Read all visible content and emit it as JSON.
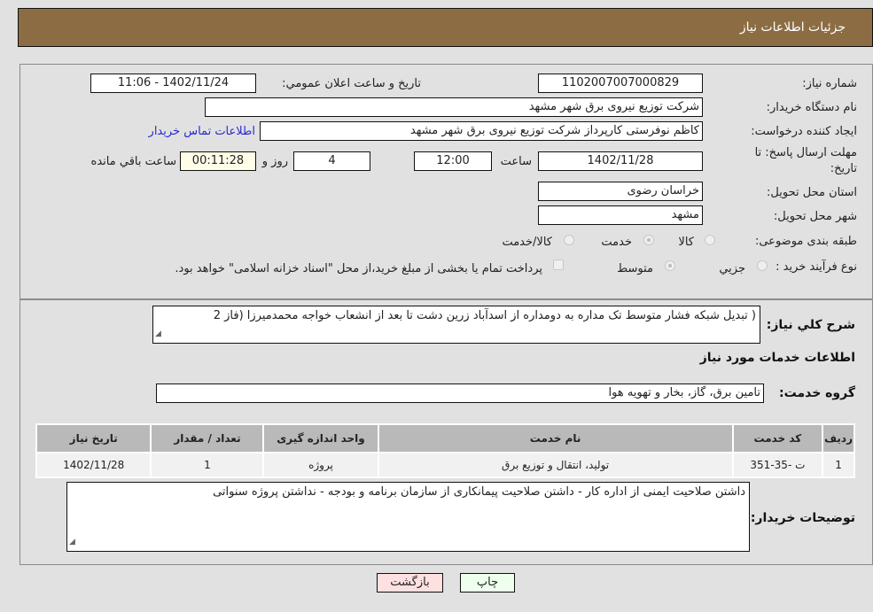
{
  "header": {
    "title": "جزئیات اطلاعات نیاز"
  },
  "form": {
    "need_number_label": "شماره نیاز:",
    "need_number": "1102007007000829",
    "announce_label": "تاریخ و ساعت اعلان عمومي:",
    "announce_value": "1402/11/24 - 11:06",
    "buyer_org_label": "نام دستگاه خریدار:",
    "buyer_org": "شرکت توزیع نیروی برق شهر مشهد",
    "creator_label": "ایجاد کننده درخواست:",
    "creator": "کاظم نوفرستی کارپرداز شرکت توزیع نیروی برق شهر مشهد",
    "contact_link": "اطلاعات تماس خریدار",
    "deadline_label_line1": "مهلت ارسال پاسخ: تا",
    "deadline_label_line2": "تاریخ:",
    "deadline_date": "1402/11/28",
    "time_label": "ساعت",
    "deadline_time": "12:00",
    "days_value": "4",
    "days_label": "روز و",
    "remaining_time": "00:11:28",
    "remaining_label": "ساعت باقي مانده",
    "province_label": "استان محل تحویل:",
    "province": "خراسان رضوی",
    "city_label": "شهر محل تحویل:",
    "city": "مشهد",
    "category_label": "طبقه بندی موضوعی:",
    "category_options": [
      "کالا",
      "خدمت",
      "کالا/خدمت"
    ],
    "category_selected": "خدمت",
    "process_label": "نوع فرآیند خرید :",
    "process_options": [
      "جزيي",
      "متوسط"
    ],
    "process_selected": "متوسط",
    "treasury_note": "پرداخت تمام یا بخشی از مبلغ خرید،از محل \"اسناد خزانه اسلامی\" خواهد بود."
  },
  "details": {
    "summary_label": "شرح كلي نياز:",
    "summary_text": "( تبدیل شبکه فشار متوسط تک مداره به دومداره از اسدآباد زرین دشت تا بعد از انشعاب خواجه محمدمیرزا (فاز 2",
    "services_heading": "اطلاعات خدمات مورد نیاز",
    "service_group_label": "گروه خدمت:",
    "service_group": "تامین برق، گاز، بخار و تهویه هوا",
    "table": {
      "headers": [
        "رديف",
        "کد خدمت",
        "نام خدمت",
        "واحد اندازه گیری",
        "تعداد / مقدار",
        "تاریخ نیاز"
      ],
      "rows": [
        [
          "1",
          "ت -35-351",
          "تولید، انتقال و توزیع برق",
          "پروژه",
          "1",
          "1402/11/28"
        ]
      ]
    },
    "buyer_notes_label": "توضیحات خریدار:",
    "buyer_notes": "داشتن صلاحیت ایمنی از اداره کار - داشتن صلاحیت پیمانکاری از سازمان برنامه و بودجه - نداشتن پروژه سنواتی"
  },
  "buttons": {
    "print": "چاپ",
    "back": "بازگشت"
  },
  "colors": {
    "header_bg": "#8c6d43",
    "print_bg": "#eeffee",
    "back_bg": "#ffe0e0",
    "link": "#2a2ad0"
  }
}
